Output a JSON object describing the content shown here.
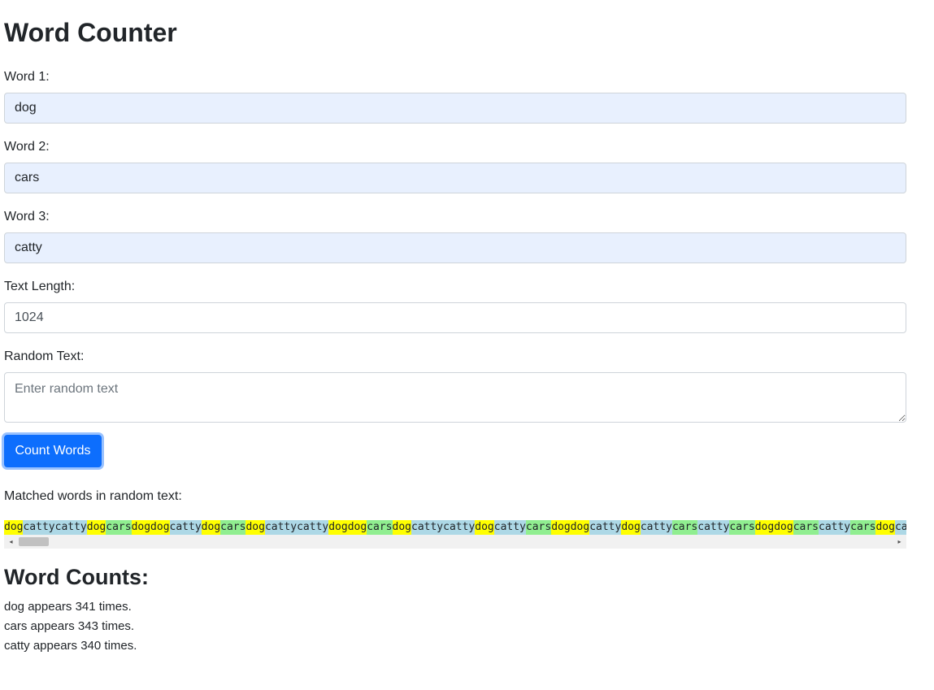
{
  "page_title": "Word Counter",
  "form": {
    "word1": {
      "label": "Word 1:",
      "value": "dog"
    },
    "word2": {
      "label": "Word 2:",
      "value": "cars"
    },
    "word3": {
      "label": "Word 3:",
      "value": "catty"
    },
    "text_length": {
      "label": "Text Length:",
      "value": "1024"
    },
    "random_text": {
      "label": "Random Text:",
      "placeholder": "Enter random text",
      "value": ""
    },
    "count_button_label": "Count Words"
  },
  "matched": {
    "label": "Matched words in random text:",
    "tokens": [
      "dog",
      "catty",
      "catty",
      "dog",
      "cars",
      "dog",
      "dog",
      "catty",
      "dog",
      "cars",
      "dog",
      "catty",
      "catty",
      "dog",
      "dog",
      "cars",
      "dog",
      "catty",
      "catty",
      "dog",
      "catty",
      "cars",
      "dog",
      "dog",
      "catty",
      "dog",
      "catty",
      "cars",
      "catty",
      "cars",
      "dog",
      "dog",
      "cars",
      "catty",
      "cars",
      "dog",
      "catt"
    ],
    "colors": {
      "dog": "#ffff00",
      "cars": "#90ee90",
      "catty": "#add8e6"
    }
  },
  "results": {
    "heading": "Word Counts:",
    "lines": [
      "dog appears 341 times.",
      "cars appears 343 times.",
      "catty appears 340 times."
    ]
  },
  "icons": {
    "scroll_left": "◂",
    "scroll_right": "▸"
  }
}
